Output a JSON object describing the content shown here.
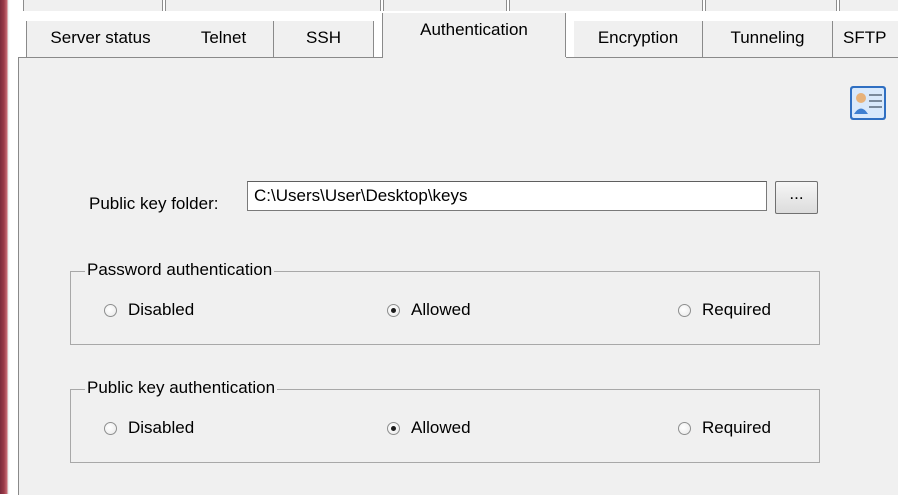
{
  "tabs": [
    {
      "label": "Server status",
      "active": false
    },
    {
      "label": "Telnet",
      "active": false
    },
    {
      "label": "SSH",
      "active": false
    },
    {
      "label": "Authentication",
      "active": true
    },
    {
      "label": "Encryption",
      "active": false
    },
    {
      "label": "Tunneling",
      "active": false
    },
    {
      "label": "SFTP",
      "active": false
    }
  ],
  "public_key": {
    "label": "Public key folder:",
    "value": "C:\\Users\\User\\Desktop\\keys",
    "browse_label": "..."
  },
  "password_auth": {
    "title": "Password authentication",
    "options": [
      "Disabled",
      "Allowed",
      "Required"
    ],
    "selected": "Allowed"
  },
  "publickey_auth": {
    "title": "Public key authentication",
    "options": [
      "Disabled",
      "Allowed",
      "Required"
    ],
    "selected": "Allowed"
  },
  "icons": {
    "contact_card": "contact-card-icon"
  }
}
